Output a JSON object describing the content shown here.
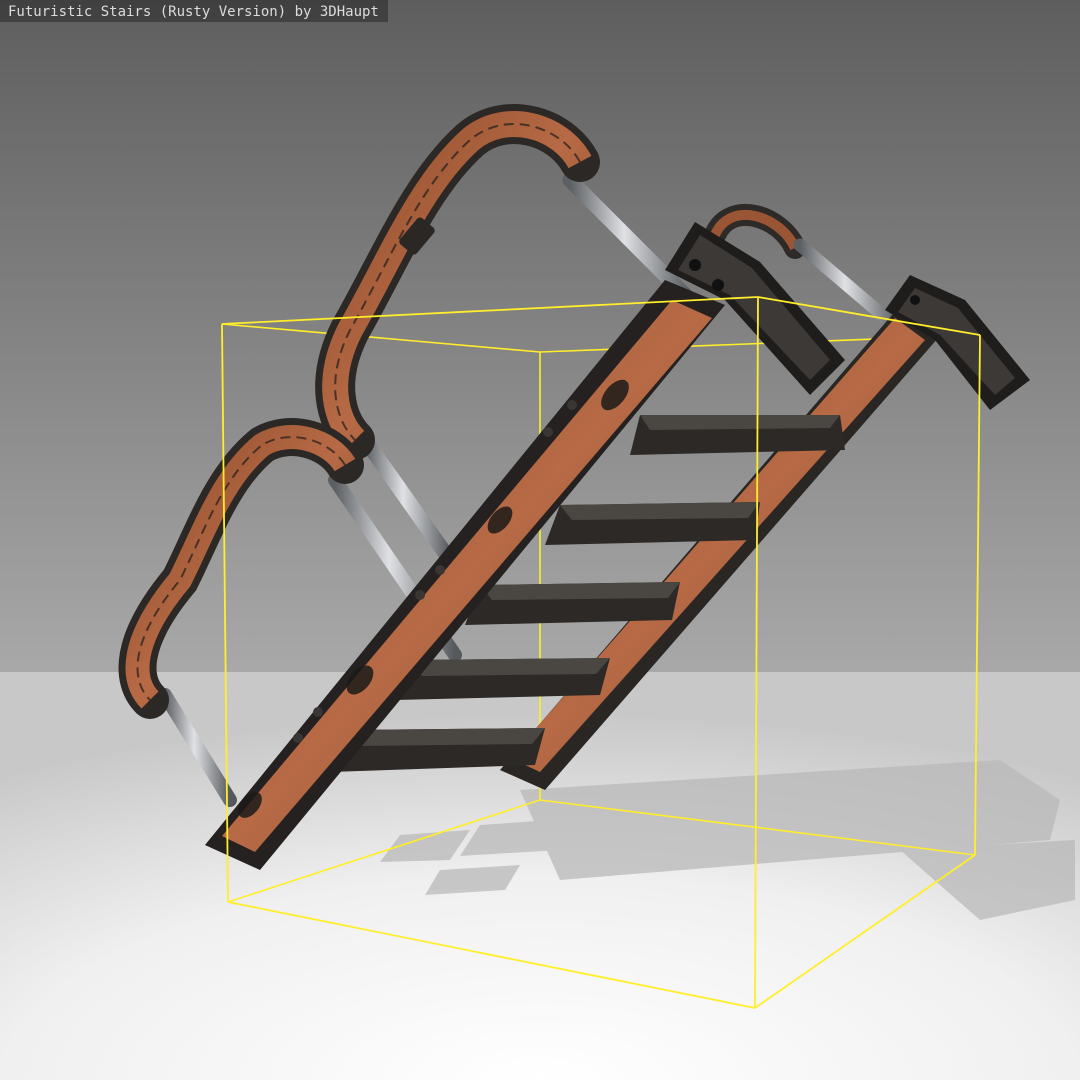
{
  "viewer": {
    "title": "Futuristic Stairs (Rusty Version) by 3DHaupt"
  },
  "colors": {
    "background_top": "#5e5e5e",
    "background_horizon": "#a9a9a9",
    "floor_far": "#cfcfcf",
    "floor_near": "#ffffff",
    "bounding_box": "#ffee2a",
    "rust": "#a85a34",
    "dark_metal": "#2e2b29",
    "steel": "#b7b9bc"
  },
  "scene": {
    "model": "futuristic-stairs",
    "material": "rusty-metal",
    "bounding_box_visible": true,
    "shadow_visible": true
  }
}
